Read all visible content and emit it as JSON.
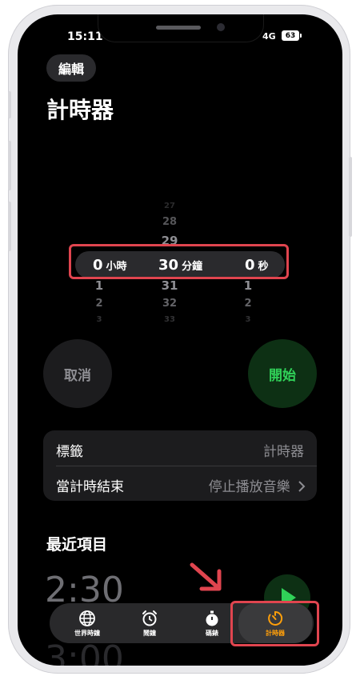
{
  "status": {
    "time": "15:11",
    "network": "4G",
    "battery": "63"
  },
  "header": {
    "edit_label": "編輯",
    "title": "計時器"
  },
  "picker": {
    "hours": {
      "above": [
        "",
        "",
        ""
      ],
      "selected": "0",
      "below": [
        "1",
        "2",
        "3"
      ],
      "unit": "小時"
    },
    "minutes": {
      "above": [
        "27",
        "28",
        "29"
      ],
      "selected": "30",
      "below": [
        "31",
        "32",
        "33"
      ],
      "unit": "分鐘"
    },
    "seconds": {
      "above": [
        "",
        "",
        ""
      ],
      "selected": "0",
      "below": [
        "1",
        "2",
        "3"
      ],
      "unit": "秒"
    }
  },
  "actions": {
    "cancel_label": "取消",
    "start_label": "開始"
  },
  "settings": {
    "label_row": {
      "label": "標籤",
      "value": "計時器"
    },
    "end_row": {
      "label": "當計時結束",
      "value": "停止播放音樂"
    }
  },
  "recent": {
    "title": "最近項目",
    "items": [
      "2:30",
      "3:00"
    ]
  },
  "tabs": [
    {
      "label": "世界時鐘",
      "icon": "globe-icon"
    },
    {
      "label": "鬧鐘",
      "icon": "alarm-clock-icon"
    },
    {
      "label": "碼錶",
      "icon": "stopwatch-icon"
    },
    {
      "label": "計時器",
      "icon": "timer-icon",
      "active": true
    }
  ],
  "colors": {
    "accent_orange": "#ff9f0a",
    "start_green": "#30d158",
    "annotation_red": "#e0454f"
  }
}
